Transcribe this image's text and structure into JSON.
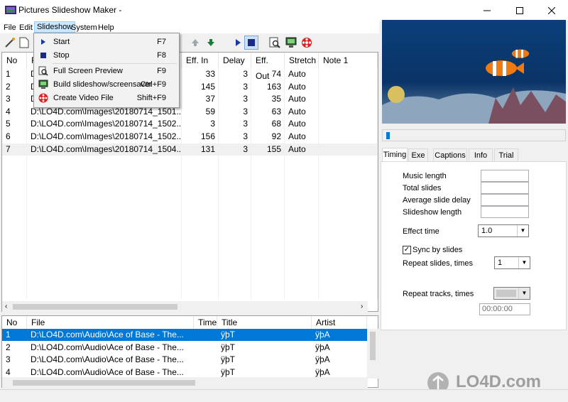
{
  "window": {
    "title": "Pictures Slideshow Maker -"
  },
  "menubar": {
    "file": "File",
    "edit": "Edit",
    "slideshow": "Slideshow",
    "system": "System",
    "help": "Help"
  },
  "slideshow_menu": {
    "items": [
      {
        "label": "Start",
        "shortcut": "F7",
        "icon": "play-icon"
      },
      {
        "label": "Stop",
        "shortcut": "F8",
        "icon": "stop-icon"
      },
      {
        "label": "Full Screen Preview",
        "shortcut": "F9",
        "icon": "preview-icon"
      },
      {
        "label": "Build slideshow/screensaver",
        "shortcut": "Ctrl+F9",
        "icon": "build-icon"
      },
      {
        "label": "Create Video File",
        "shortcut": "Shift+F9",
        "icon": "video-reel-icon"
      }
    ]
  },
  "images_table": {
    "columns": [
      "No",
      "F",
      "Eff. In",
      "Delay",
      "Eff. Out",
      "Stretch",
      "Note 1"
    ],
    "rows": [
      {
        "no": "1",
        "file": "D",
        "eff_in": "33",
        "delay": "3",
        "eff_out": "74",
        "stretch": "Auto"
      },
      {
        "no": "2",
        "file": "D",
        "eff_in": "145",
        "delay": "3",
        "eff_out": "163",
        "stretch": "Auto"
      },
      {
        "no": "3",
        "file": "D",
        "eff_in": "37",
        "delay": "3",
        "eff_out": "35",
        "stretch": "Auto"
      },
      {
        "no": "4",
        "file": "D:\\LO4D.com\\Images\\20180714_1501...",
        "eff_in": "59",
        "delay": "3",
        "eff_out": "63",
        "stretch": "Auto"
      },
      {
        "no": "5",
        "file": "D:\\LO4D.com\\Images\\20180714_1502...",
        "eff_in": "3",
        "delay": "3",
        "eff_out": "68",
        "stretch": "Auto"
      },
      {
        "no": "6",
        "file": "D:\\LO4D.com\\Images\\20180714_1502...",
        "eff_in": "156",
        "delay": "3",
        "eff_out": "92",
        "stretch": "Auto"
      },
      {
        "no": "7",
        "file": "D:\\LO4D.com\\Images\\20180714_1504...",
        "eff_in": "131",
        "delay": "3",
        "eff_out": "155",
        "stretch": "Auto"
      }
    ]
  },
  "audio_table": {
    "columns": [
      "No",
      "File",
      "Time",
      "Title",
      "Artist"
    ],
    "rows": [
      {
        "no": "1",
        "file": "D:\\LO4D.com\\Audio\\Ace of Base - The...",
        "time": "",
        "title": "ÿþT",
        "artist": "ÿþA"
      },
      {
        "no": "2",
        "file": "D:\\LO4D.com\\Audio\\Ace of Base - The...",
        "time": "",
        "title": "ÿþT",
        "artist": "ÿþA"
      },
      {
        "no": "3",
        "file": "D:\\LO4D.com\\Audio\\Ace of Base - The...",
        "time": "",
        "title": "ÿþT",
        "artist": "ÿþA"
      },
      {
        "no": "4",
        "file": "D:\\LO4D.com\\Audio\\Ace of Base - The...",
        "time": "",
        "title": "ÿþT",
        "artist": "ÿþA"
      }
    ]
  },
  "tabs": [
    "Timing",
    "Exe",
    "Captions",
    "Info",
    "Trial"
  ],
  "timing": {
    "music_length": "Music length",
    "total_slides": "Total slides",
    "avg_delay": "Average slide delay",
    "slideshow_length": "Slideshow length",
    "effect_time_label": "Effect time",
    "effect_time_value": "1.0",
    "sync_label": "Sync by slides",
    "sync_checked": true,
    "repeat_slides_label": "Repeat slides, times",
    "repeat_slides_value": "1",
    "repeat_tracks_label": "Repeat tracks, times",
    "repeat_tracks_value": "",
    "time_value": "00:00:00"
  },
  "watermark": "LO4D.com",
  "colors": {
    "selection": "#0078d7",
    "play": "#1a3b9a",
    "reel": "#e02020"
  }
}
